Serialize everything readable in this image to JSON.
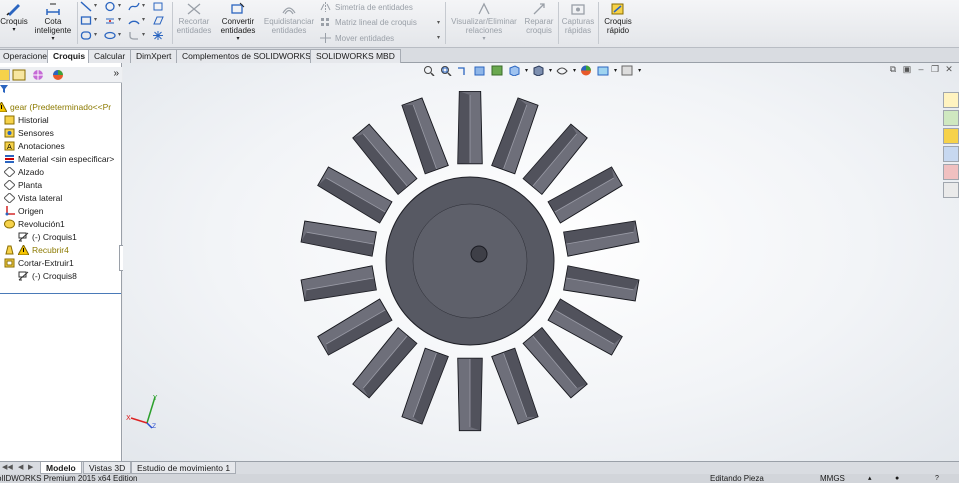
{
  "ribbon": {
    "croquis_label": "Croquis",
    "cota_label": "Cota\ninteligente",
    "recortar_label": "Recortar\nentidades",
    "convertir_label": "Convertir\nentidades",
    "equidistanciar_label": "Equidistanciar\nentidades",
    "simetria_label": "Simetría de entidades",
    "matriz_label": "Matriz lineal de croquis",
    "mover_label": "Mover entidades",
    "visualizar_label": "Visualizar/Eliminar\nrelaciones",
    "reparar_label": "Reparar\ncroquis",
    "capturas_label": "Capturas\nrápidas",
    "croquis_rapido_label": "Croquis\nrápido"
  },
  "tabs": [
    {
      "label": "Operaciones"
    },
    {
      "label": "Croquis"
    },
    {
      "label": "Calcular"
    },
    {
      "label": "DimXpert"
    },
    {
      "label": "Complementos de SOLIDWORKS"
    },
    {
      "label": "SOLIDWORKS MBD"
    }
  ],
  "tree": {
    "root": "gear  (Predeterminado<<Pr",
    "items": [
      {
        "label": "Historial"
      },
      {
        "label": "Sensores"
      },
      {
        "label": "Anotaciones"
      },
      {
        "label": "Material <sin especificar>"
      },
      {
        "label": "Alzado"
      },
      {
        "label": "Planta"
      },
      {
        "label": "Vista lateral"
      },
      {
        "label": "Origen"
      },
      {
        "label": "Revolución1"
      },
      {
        "label": "(-) Croquis1"
      },
      {
        "label": "Recubrir4"
      },
      {
        "label": "Cortar-Extruir1"
      },
      {
        "label": "(-) Croquis8"
      }
    ]
  },
  "triad": {
    "x": "X",
    "y": "Y",
    "z": "Z"
  },
  "bottom_tabs": [
    {
      "label": "Modelo"
    },
    {
      "label": "Vistas 3D"
    },
    {
      "label": "Estudio de movimiento 1"
    }
  ],
  "status": {
    "left": "olIDWORKS Premium 2015 x64 Edition",
    "editing": "Editando Pieza",
    "units": "MMGS"
  },
  "colors": {
    "gear_face": "#6e6f7a",
    "gear_dark": "#3a3b44",
    "accent_tab": "#ffffff"
  }
}
